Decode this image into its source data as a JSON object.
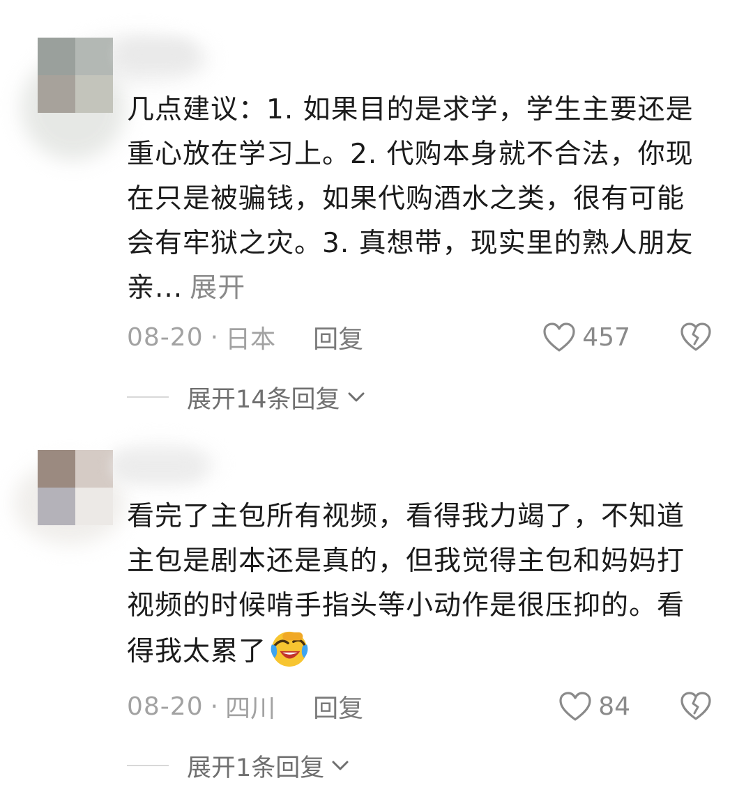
{
  "comments": [
    {
      "text": "几点建议：1. 如果目的是求学，学生主要还是重心放在学习上。2. 代购本身就不合法，你现在只是被骗钱，如果代购酒水之类，很有可能会有牢狱之灾。3. 真想带，现实里的熟人朋友亲...",
      "expand_label": "展开",
      "date": "08-20",
      "location": "日本",
      "reply_label": "回复",
      "likes": "457",
      "replies_label": "展开14条回复"
    },
    {
      "text": "看完了主包所有视频，看得我力竭了，不知道主包是剧本还是真的，但我觉得主包和妈妈打视频的时候啃手指头等小动作是很压抑的。看得我太累了",
      "emoji": "crying-laughing-emoji",
      "date": "08-20",
      "location": "四川",
      "reply_label": "回复",
      "likes": "84",
      "replies_label": "展开1条回复"
    }
  ],
  "separator_dot": "·",
  "icons": {
    "like": "heart-outline-icon",
    "dislike": "broken-heart-icon",
    "expand": "chevron-down-icon"
  },
  "colors": {
    "text": "#1b1b1b",
    "meta": "#a2a2a2",
    "link": "#6f6f6f"
  }
}
